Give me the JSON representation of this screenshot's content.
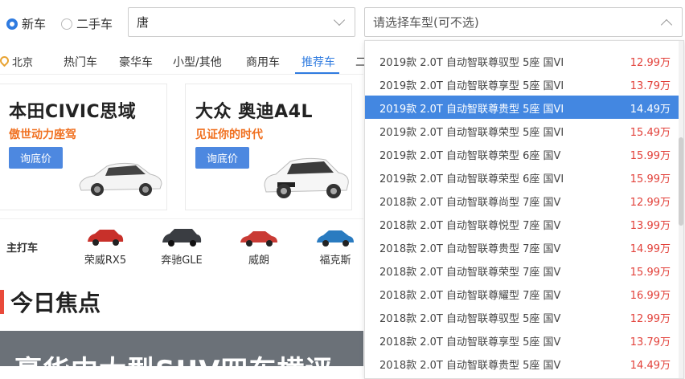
{
  "filters": {
    "radios": [
      {
        "label": "新车",
        "checked": true
      },
      {
        "label": "二手车",
        "checked": false
      }
    ],
    "brand_value": "唐",
    "model_placeholder": "请选择车型(可不选)"
  },
  "nav": {
    "location": "北京",
    "tabs": [
      "热门车",
      "豪华车",
      "小型/其他",
      "商用车",
      "推荐车",
      "二"
    ],
    "active_tab": "推荐车"
  },
  "cards": [
    {
      "name": "本田CIVIC思域",
      "slogan": "傲世动力座驾",
      "button": "询底价"
    },
    {
      "name": "大众 奥迪A4L",
      "slogan": "见证你的时代",
      "button": "询底价"
    }
  ],
  "main_cars": {
    "label": "主打车",
    "items": [
      {
        "name": "荣威RX5",
        "color": "#c8302a"
      },
      {
        "name": "奔驰GLE",
        "color": "#3a3d42"
      },
      {
        "name": "威朗",
        "color": "#c93b35"
      },
      {
        "name": "福克斯",
        "color": "#2a7bc0"
      }
    ]
  },
  "focus": {
    "title": "今日焦点",
    "banner_text": "豪华中大型SUV四车横评"
  },
  "dropdown": {
    "selected_index": 2,
    "options": [
      {
        "text": "2019款 2.0T 自动智联尊驭型 5座 国VI",
        "price": "12.99万"
      },
      {
        "text": "2019款 2.0T 自动智联尊享型 5座 国VI",
        "price": "13.79万"
      },
      {
        "text": "2019款 2.0T 自动智联尊贵型 5座 国VI",
        "price": "14.49万"
      },
      {
        "text": "2019款 2.0T 自动智联尊荣型 5座 国VI",
        "price": "15.49万"
      },
      {
        "text": "2019款 2.0T 自动智联尊荣型 6座 国V",
        "price": "15.99万"
      },
      {
        "text": "2019款 2.0T 自动智联尊荣型 6座 国VI",
        "price": "15.99万"
      },
      {
        "text": "2018款 2.0T 自动智联尊尚型 7座 国V",
        "price": "12.99万"
      },
      {
        "text": "2018款 2.0T 自动智联尊悦型 7座 国V",
        "price": "13.99万"
      },
      {
        "text": "2018款 2.0T 自动智联尊贵型 7座 国V",
        "price": "14.99万"
      },
      {
        "text": "2018款 2.0T 自动智联尊荣型 7座 国V",
        "price": "15.99万"
      },
      {
        "text": "2018款 2.0T 自动智联尊耀型 7座 国V",
        "price": "16.99万"
      },
      {
        "text": "2018款 2.0T 自动智联尊驭型 5座 国V",
        "price": "12.99万"
      },
      {
        "text": "2018款 2.0T 自动智联尊享型 5座 国V",
        "price": "13.79万"
      },
      {
        "text": "2018款 2.0T 自动智联尊贵型 5座 国V",
        "price": "14.49万"
      }
    ]
  },
  "colors": {
    "accent": "#2f7be0",
    "price": "#e2413a",
    "slogan": "#f07020",
    "selected_row": "#4387e1"
  }
}
